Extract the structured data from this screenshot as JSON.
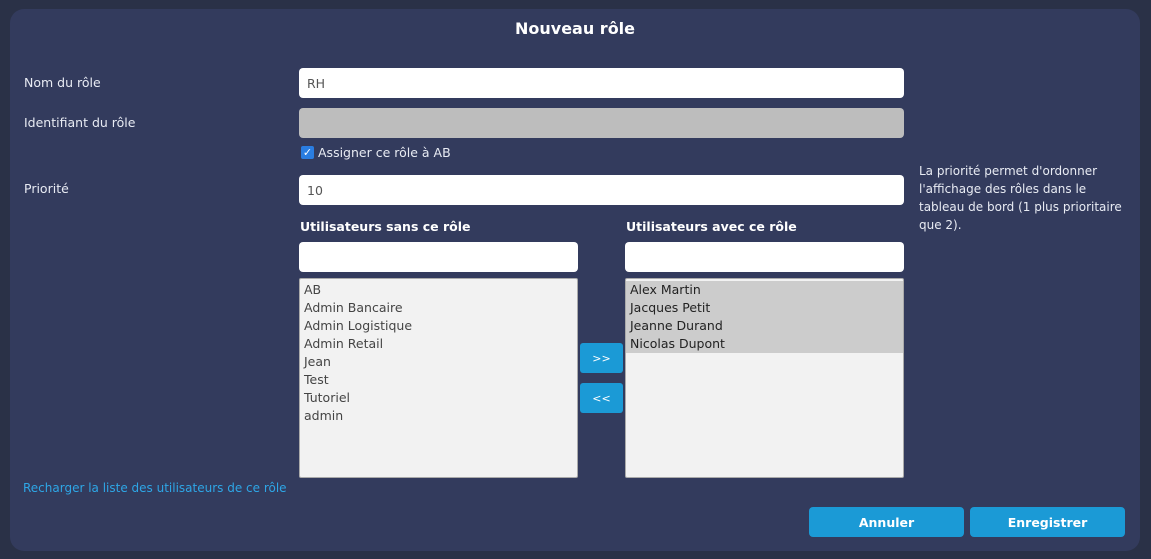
{
  "dialog": {
    "title": "Nouveau rôle"
  },
  "form": {
    "role_name_label": "Nom du rôle",
    "role_name_value": "RH",
    "role_id_label": "Identifiant du rôle",
    "role_id_value": "",
    "assign_checkbox_label": "Assigner ce rôle à AB",
    "assign_checked": true,
    "priority_label": "Priorité",
    "priority_value": "10",
    "priority_help": "La priorité permet d'ordonner l'affichage des rôles dans le tableau de bord (1 plus prioritaire que 2)."
  },
  "users_without": {
    "title": "Utilisateurs sans ce rôle",
    "filter_value": "",
    "items": [
      "AB",
      "Admin Bancaire",
      "Admin Logistique",
      "Admin Retail",
      "Jean",
      "Test",
      "Tutoriel",
      "admin"
    ]
  },
  "users_with": {
    "title": "Utilisateurs avec ce rôle",
    "filter_value": "",
    "items": [
      "Alex Martin",
      "Jacques Petit",
      "Jeanne Durand",
      "Nicolas Dupont"
    ]
  },
  "transfer": {
    "add_label": ">>",
    "remove_label": "<<"
  },
  "links": {
    "reload_label": "Recharger la liste des utilisateurs de ce rôle"
  },
  "footer": {
    "cancel_label": "Annuler",
    "save_label": "Enregistrer"
  },
  "colors": {
    "background": "#2a3147",
    "panel": "#333b5d",
    "accent": "#1b9ad6",
    "link": "#2ea6e6"
  }
}
